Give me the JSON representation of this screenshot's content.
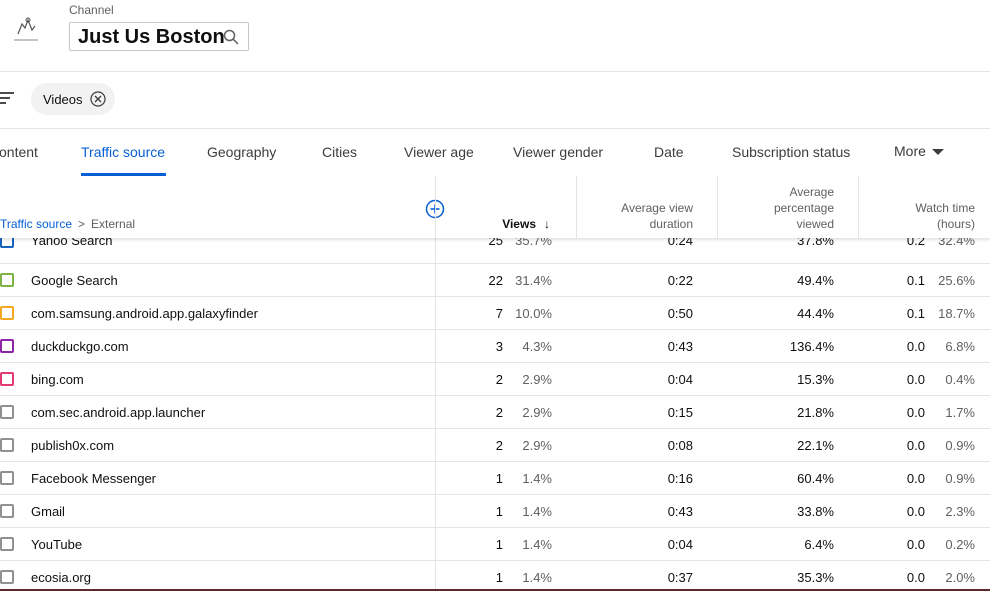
{
  "header": {
    "channel_label": "Channel",
    "channel_name": "Just Us Boston"
  },
  "filters": {
    "chip_label": "Videos"
  },
  "tabs": [
    {
      "label": "ontent",
      "active": false
    },
    {
      "label": "Traffic source",
      "active": true
    },
    {
      "label": "Geography",
      "active": false
    },
    {
      "label": "Cities",
      "active": false
    },
    {
      "label": "Viewer age",
      "active": false
    },
    {
      "label": "Viewer gender",
      "active": false
    },
    {
      "label": "Date",
      "active": false
    },
    {
      "label": "Subscription status",
      "active": false
    },
    {
      "label": "More",
      "active": false
    }
  ],
  "breadcrumb": {
    "root": "Traffic source",
    "separator": ">",
    "current": "External"
  },
  "columns": {
    "views": "Views",
    "avg_view_duration_1": "Average view",
    "avg_view_duration_2": "duration",
    "avg_pct_viewed_1": "Average",
    "avg_pct_viewed_2": "percentage",
    "avg_pct_viewed_3": "viewed",
    "watch_time_1": "Watch time",
    "watch_time_2": "(hours)"
  },
  "rows": [
    {
      "source": "Yahoo Search",
      "views": "25",
      "views_pct": "35.7%",
      "duration": "0:24",
      "avg_pct": "37.8%",
      "watch": "0.2",
      "watch_pct": "32.4%",
      "color": "#1565c0"
    },
    {
      "source": "Google Search",
      "views": "22",
      "views_pct": "31.4%",
      "duration": "0:22",
      "avg_pct": "49.4%",
      "watch": "0.1",
      "watch_pct": "25.6%",
      "color": "#7cb342"
    },
    {
      "source": "com.samsung.android.app.galaxyfinder",
      "views": "7",
      "views_pct": "10.0%",
      "duration": "0:50",
      "avg_pct": "44.4%",
      "watch": "0.1",
      "watch_pct": "18.7%",
      "color": "#f5a623"
    },
    {
      "source": "duckduckgo.com",
      "views": "3",
      "views_pct": "4.3%",
      "duration": "0:43",
      "avg_pct": "136.4%",
      "watch": "0.0",
      "watch_pct": "6.8%",
      "color": "#8e24aa"
    },
    {
      "source": "bing.com",
      "views": "2",
      "views_pct": "2.9%",
      "duration": "0:04",
      "avg_pct": "15.3%",
      "watch": "0.0",
      "watch_pct": "0.4%",
      "color": "#e53975"
    },
    {
      "source": "com.sec.android.app.launcher",
      "views": "2",
      "views_pct": "2.9%",
      "duration": "0:15",
      "avg_pct": "21.8%",
      "watch": "0.0",
      "watch_pct": "1.7%",
      "color": "#909090"
    },
    {
      "source": "publish0x.com",
      "views": "2",
      "views_pct": "2.9%",
      "duration": "0:08",
      "avg_pct": "22.1%",
      "watch": "0.0",
      "watch_pct": "0.9%",
      "color": "#909090"
    },
    {
      "source": "Facebook Messenger",
      "views": "1",
      "views_pct": "1.4%",
      "duration": "0:16",
      "avg_pct": "60.4%",
      "watch": "0.0",
      "watch_pct": "0.9%",
      "color": "#909090"
    },
    {
      "source": "Gmail",
      "views": "1",
      "views_pct": "1.4%",
      "duration": "0:43",
      "avg_pct": "33.8%",
      "watch": "0.0",
      "watch_pct": "2.3%",
      "color": "#909090"
    },
    {
      "source": "YouTube",
      "views": "1",
      "views_pct": "1.4%",
      "duration": "0:04",
      "avg_pct": "6.4%",
      "watch": "0.0",
      "watch_pct": "0.2%",
      "color": "#909090"
    },
    {
      "source": "ecosia.org",
      "views": "1",
      "views_pct": "1.4%",
      "duration": "0:37",
      "avg_pct": "35.3%",
      "watch": "0.0",
      "watch_pct": "2.0%",
      "color": "#909090"
    }
  ],
  "icons": {
    "logo": "channel-logo",
    "search": "search-icon",
    "filter": "filter-icon",
    "chip_close": "close-circle-icon",
    "add_column": "add-circle-icon",
    "sort": "arrow-down-icon",
    "more": "caret-down-icon"
  },
  "colors": {
    "accent": "#065fd4",
    "divider": "#e5e5e5",
    "chip_bg": "#f2f2f2"
  }
}
